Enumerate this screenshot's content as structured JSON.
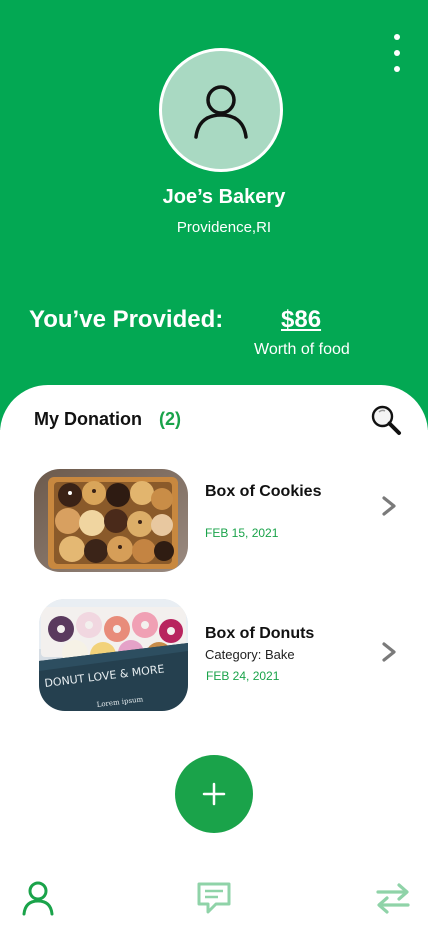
{
  "profile": {
    "name": "Joe’s Bakery",
    "location": "Providence,RI"
  },
  "summary": {
    "label": "You’ve Provided:",
    "amount": "$86",
    "sublabel": "Worth of food"
  },
  "donations": {
    "title": "My Donation",
    "count": "(2)",
    "items": [
      {
        "title": "Box of Cookies",
        "category": "",
        "date": "FEB 15, 2021",
        "image": "cookies-photo"
      },
      {
        "title": "Box of Donuts",
        "category": "Category: Bake",
        "date": "FEB 24, 2021",
        "image": "donuts-photo"
      }
    ]
  },
  "icons": {
    "menu": "more-vertical-icon",
    "avatar": "user-icon",
    "search": "search-icon",
    "chevron": "chevron-right-icon",
    "add": "plus-icon",
    "nav": [
      "user-icon",
      "chat-icon",
      "swap-icon"
    ]
  },
  "colors": {
    "brand": "#03a853",
    "accent": "#1aa34a",
    "avatar_bg": "#a9d9c2",
    "nav_inactive": "#8fd3a8"
  }
}
